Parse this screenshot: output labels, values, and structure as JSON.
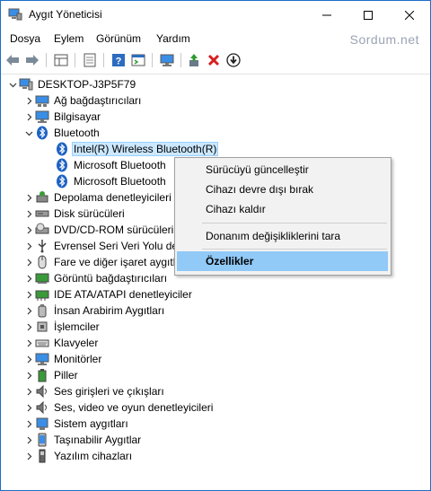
{
  "window": {
    "title": "Aygıt Yöneticisi",
    "accent": "#1a6fc9"
  },
  "menu": {
    "items": [
      "Dosya",
      "Eylem",
      "Görünüm",
      "Yardım"
    ]
  },
  "watermark": "Sordum.net",
  "toolbar": {
    "icons": [
      "back-icon",
      "forward-icon",
      "properties-grid-icon",
      "page-icon",
      "help-icon",
      "console-icon",
      "monitor-icon",
      "update-driver-icon",
      "remove-x-icon",
      "download-circle-icon"
    ]
  },
  "tree": {
    "root": "DESKTOP-J3P5F79",
    "categories": [
      "Ağ bağdaştırıcıları",
      "Bilgisayar",
      "Bluetooth",
      "Depolama denetleyicileri",
      "Disk sürücüleri",
      "DVD/CD-ROM sürücüleri",
      "Evrensel Seri Veri Yolu denetleyicileri",
      "Fare ve diğer işaret aygıtları",
      "Görüntü bağdaştırıcıları",
      "IDE ATA/ATAPI denetleyiciler",
      "İnsan Arabirim Aygıtları",
      "İşlemciler",
      "Klavyeler",
      "Monitörler",
      "Piller",
      "Ses girişleri ve çıkışları",
      "Ses, video ve oyun denetleyicileri",
      "Sistem aygıtları",
      "Taşınabilir Aygıtlar",
      "Yazılım cihazları"
    ],
    "bluetooth_children": [
      "Intel(R) Wireless Bluetooth(R)",
      "Microsoft Bluetooth",
      "Microsoft Bluetooth"
    ]
  },
  "context_menu": {
    "items": [
      "Sürücüyü güncelleştir",
      "Cihazı devre dışı bırak",
      "Cihazı kaldır",
      "Donanım değişikliklerini tara",
      "Özellikler"
    ]
  }
}
